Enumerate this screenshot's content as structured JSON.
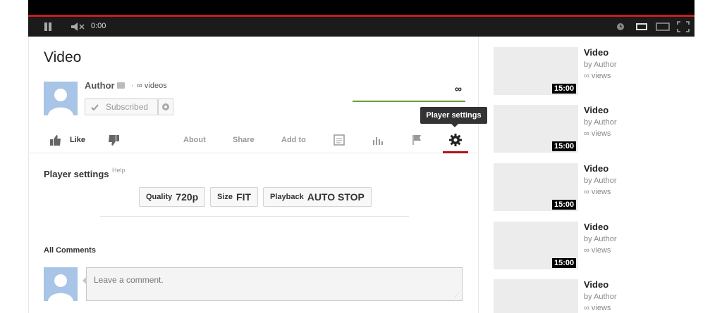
{
  "player": {
    "time": "0:00",
    "icons": [
      "pause-icon",
      "volume-icon",
      "clock-icon",
      "small-player-icon",
      "large-player-icon",
      "fullscreen-icon"
    ],
    "progress_color": "#cc181e"
  },
  "video": {
    "title": "Video",
    "author": "Author",
    "dot": "·",
    "videos_count": "∞ videos",
    "subscribe_label": "Subscribed",
    "view_count": "∞"
  },
  "actions": {
    "like_label": "Like",
    "tabs": [
      "About",
      "Share",
      "Add to"
    ],
    "tooltip": "Player settings",
    "active_color": "#b31217"
  },
  "player_settings": {
    "title": "Player settings",
    "help": "Help",
    "options": [
      {
        "key": "Quality",
        "value": "720p"
      },
      {
        "key": "Size",
        "value": "FIT"
      },
      {
        "key": "Playback",
        "value": "AUTO STOP"
      }
    ]
  },
  "comments": {
    "title": "All Comments",
    "placeholder": "Leave a comment."
  },
  "related": [
    {
      "title": "Video",
      "by": "by Author",
      "views": "∞ views",
      "duration": "15:00"
    },
    {
      "title": "Video",
      "by": "by Author",
      "views": "∞ views",
      "duration": "15:00"
    },
    {
      "title": "Video",
      "by": "by Author",
      "views": "∞ views",
      "duration": "15:00"
    },
    {
      "title": "Video",
      "by": "by Author",
      "views": "∞ views",
      "duration": "15:00"
    },
    {
      "title": "Video",
      "by": "by Author",
      "views": "∞ views",
      "duration": ""
    }
  ]
}
